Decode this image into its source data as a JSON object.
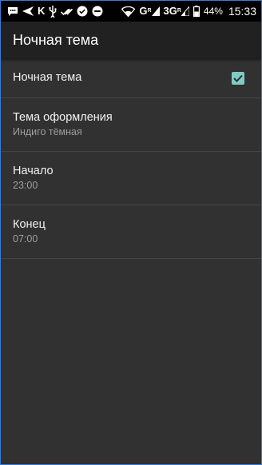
{
  "status_bar": {
    "icons": [
      "message-icon",
      "send-icon",
      "k-app-icon",
      "usb-icon",
      "done-all-icon",
      "check-circle-icon",
      "do-not-disturb-icon",
      "wifi-icon",
      "signal-g-icon",
      "signal-3g-icon",
      "battery-icon"
    ],
    "net1": "G",
    "net2": "3G",
    "net_sup": "R",
    "battery": "44%",
    "time": "15:33"
  },
  "app_bar": {
    "title": "Ночная тема"
  },
  "settings": {
    "night_mode": {
      "title": "Ночная тема",
      "checked": true
    },
    "theme": {
      "title": "Тема оформления",
      "summary": "Индиго тёмная"
    },
    "start": {
      "title": "Начало",
      "summary": "23:00"
    },
    "end": {
      "title": "Конец",
      "summary": "07:00"
    }
  },
  "colors": {
    "background": "#313131",
    "app_bar": "#212121",
    "accent": "#80cbc4",
    "divider": "#454545"
  }
}
